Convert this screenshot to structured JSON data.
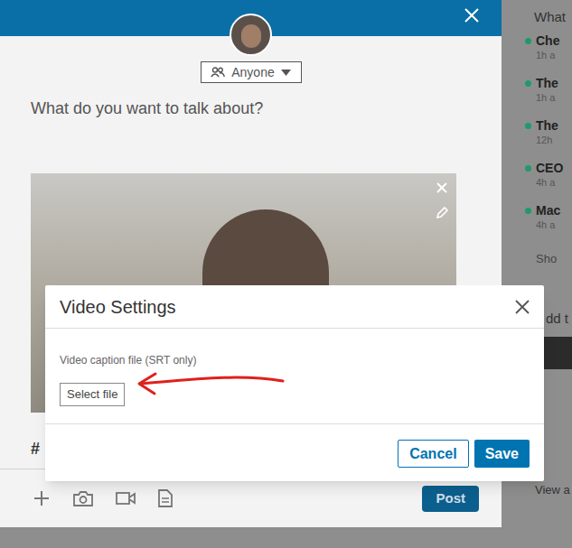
{
  "composer": {
    "visibility": "Anyone",
    "placeholder": "What do you want to talk about?",
    "hashtag": "#",
    "post_button": "Post"
  },
  "sidebar": {
    "heading": "What",
    "items": [
      {
        "title": "Che",
        "meta": "1h a"
      },
      {
        "title": "The",
        "meta": "1h a"
      },
      {
        "title": "The",
        "meta": "12h"
      },
      {
        "title": "CEO",
        "meta": "4h a"
      },
      {
        "title": "Mac",
        "meta": "4h a"
      }
    ],
    "show_more": "Sho",
    "add_heading": "dd t",
    "view_all": "View a"
  },
  "dialog": {
    "title": "Video Settings",
    "field_label": "Video caption file (SRT only)",
    "select_button": "Select file",
    "buttons": [
      "Cancel",
      "Save"
    ]
  }
}
